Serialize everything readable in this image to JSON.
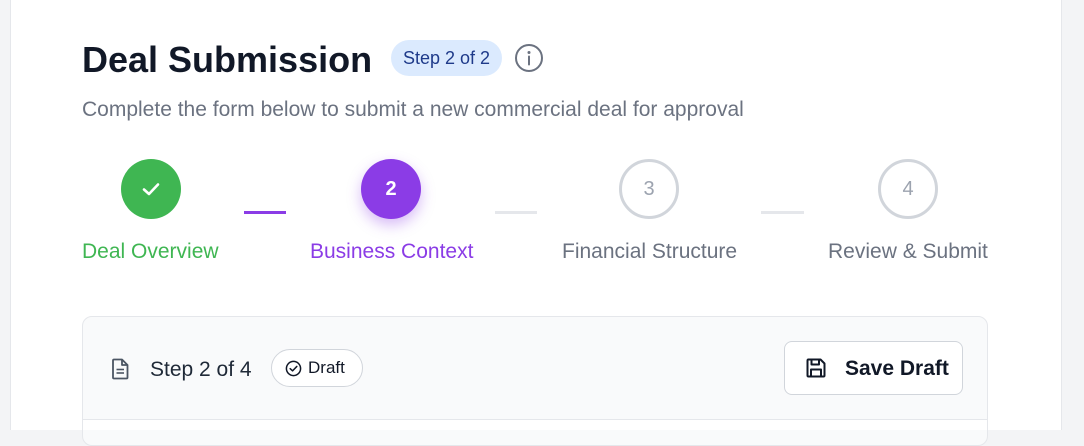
{
  "header": {
    "title": "Deal Submission",
    "step_pill": "Step 2 of 2",
    "info_icon": "info-icon",
    "subtitle": "Complete the form below to submit a new commercial deal for approval"
  },
  "stepper": {
    "steps": [
      {
        "number": "",
        "label": "Deal Overview",
        "status": "completed",
        "icon": "check-icon"
      },
      {
        "number": "2",
        "label": "Business Context",
        "status": "active"
      },
      {
        "number": "3",
        "label": "Financial Structure",
        "status": "pending"
      },
      {
        "number": "4",
        "label": "Review & Submit",
        "status": "pending"
      }
    ]
  },
  "card": {
    "icon": "document-icon",
    "step_text": "Step 2 of 4",
    "badge_label": "Draft",
    "badge_icon": "check-circle-icon",
    "save_label": "Save Draft",
    "save_icon": "save-icon"
  },
  "colors": {
    "completed": "#3fb652",
    "active": "#8b3ce6",
    "pending": "#d1d5db",
    "pill_bg": "#dbeafe",
    "pill_text": "#1e3a8a"
  }
}
